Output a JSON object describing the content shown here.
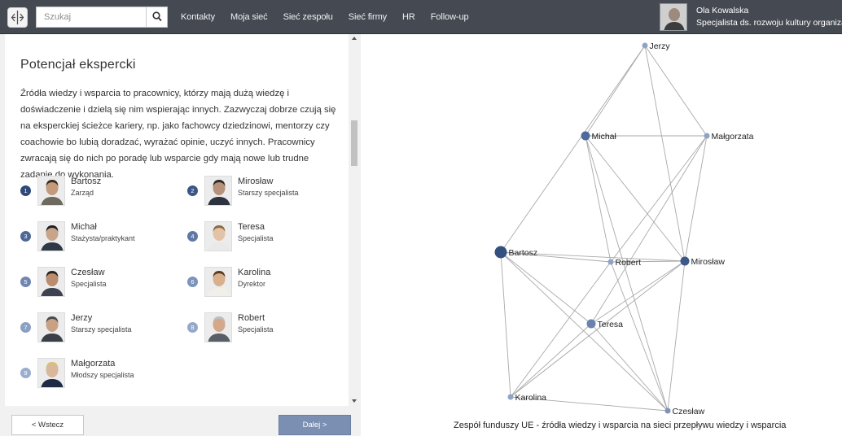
{
  "header": {
    "search_placeholder": "Szukaj",
    "nav": [
      "Kontakty",
      "Moja sieć",
      "Sieć zespołu",
      "Sieć firmy",
      "HR",
      "Follow-up"
    ],
    "user_name": "Ola Kowalska",
    "user_role": "Specjalista ds. rozwoju kultury organizacji"
  },
  "panel": {
    "title": "Potencjał ekspercki",
    "description": "Źródła wiedzy i wsparcia to pracownicy, którzy mają dużą wiedzę i doświadczenie i dzielą się nim wspierając innych. Zazwyczaj dobrze czują się na eksperckiej ścieżce kariery, np. jako fachowcy dziedzinowi, mentorzy czy coachowie bo lubią doradzać, wyrażać opinie, uczyć innych. Pracownicy zwracają się do nich po poradę lub wsparcie gdy mają nowe lub trudne zadanie do wykonania.",
    "people": [
      {
        "rank": "1",
        "name": "Bartosz",
        "role": "Zarząd"
      },
      {
        "rank": "2",
        "name": "Mirosław",
        "role": "Starszy specjalista"
      },
      {
        "rank": "3",
        "name": "Michał",
        "role": "Stażysta/praktykant"
      },
      {
        "rank": "4",
        "name": "Teresa",
        "role": "Specjalista"
      },
      {
        "rank": "5",
        "name": "Czesław",
        "role": "Specjalista"
      },
      {
        "rank": "6",
        "name": "Karolina",
        "role": "Dyrektor"
      },
      {
        "rank": "7",
        "name": "Jerzy",
        "role": "Starszy specjalista"
      },
      {
        "rank": "8",
        "name": "Robert",
        "role": "Specjalista"
      },
      {
        "rank": "9",
        "name": "Małgorzata",
        "role": "Młodszy specjalista"
      }
    ],
    "back_label": "< Wstecz",
    "next_label": "Dalej >"
  },
  "graph": {
    "caption": "Zespół funduszy UE - źródła wiedzy i wsparcia na sieci przepływu wiedzy i wsparcia",
    "nodes": [
      {
        "name": "Jerzy",
        "size": "small",
        "color": "#8fa3c6"
      },
      {
        "name": "Michał",
        "size": "medium",
        "color": "#4d6a9c"
      },
      {
        "name": "Małgorzata",
        "size": "small",
        "color": "#8fa3c6"
      },
      {
        "name": "Bartosz",
        "size": "large",
        "color": "#34507f"
      },
      {
        "name": "Robert",
        "size": "small",
        "color": "#8fa3c6"
      },
      {
        "name": "Mirosław",
        "size": "medium",
        "color": "#3c5888"
      },
      {
        "name": "Teresa",
        "size": "medium",
        "color": "#6a82ad"
      },
      {
        "name": "Karolina",
        "size": "small",
        "color": "#8fa3c6"
      },
      {
        "name": "Czesław",
        "size": "small",
        "color": "#7d93bb"
      }
    ],
    "edges": [
      [
        "Jerzy",
        "Michał"
      ],
      [
        "Jerzy",
        "Małgorzata"
      ],
      [
        "Jerzy",
        "Mirosław"
      ],
      [
        "Jerzy",
        "Bartosz"
      ],
      [
        "Michał",
        "Małgorzata"
      ],
      [
        "Michał",
        "Robert"
      ],
      [
        "Michał",
        "Mirosław"
      ],
      [
        "Michał",
        "Czesław"
      ],
      [
        "Małgorzata",
        "Mirosław"
      ],
      [
        "Małgorzata",
        "Robert"
      ],
      [
        "Małgorzata",
        "Teresa"
      ],
      [
        "Bartosz",
        "Robert"
      ],
      [
        "Bartosz",
        "Mirosław"
      ],
      [
        "Bartosz",
        "Teresa"
      ],
      [
        "Bartosz",
        "Karolina"
      ],
      [
        "Bartosz",
        "Czesław"
      ],
      [
        "Robert",
        "Mirosław"
      ],
      [
        "Robert",
        "Karolina"
      ],
      [
        "Robert",
        "Czesław"
      ],
      [
        "Mirosław",
        "Teresa"
      ],
      [
        "Mirosław",
        "Karolina"
      ],
      [
        "Mirosław",
        "Czesław"
      ],
      [
        "Teresa",
        "Karolina"
      ],
      [
        "Teresa",
        "Czesław"
      ],
      [
        "Karolina",
        "Czesław"
      ]
    ]
  },
  "rank_colors": [
    "#2f4a78",
    "#3a5686",
    "#4d6797",
    "#5f78a5",
    "#7086b0",
    "#7d93bb",
    "#8b9fc3",
    "#95a8ca",
    "#9aadcd"
  ]
}
